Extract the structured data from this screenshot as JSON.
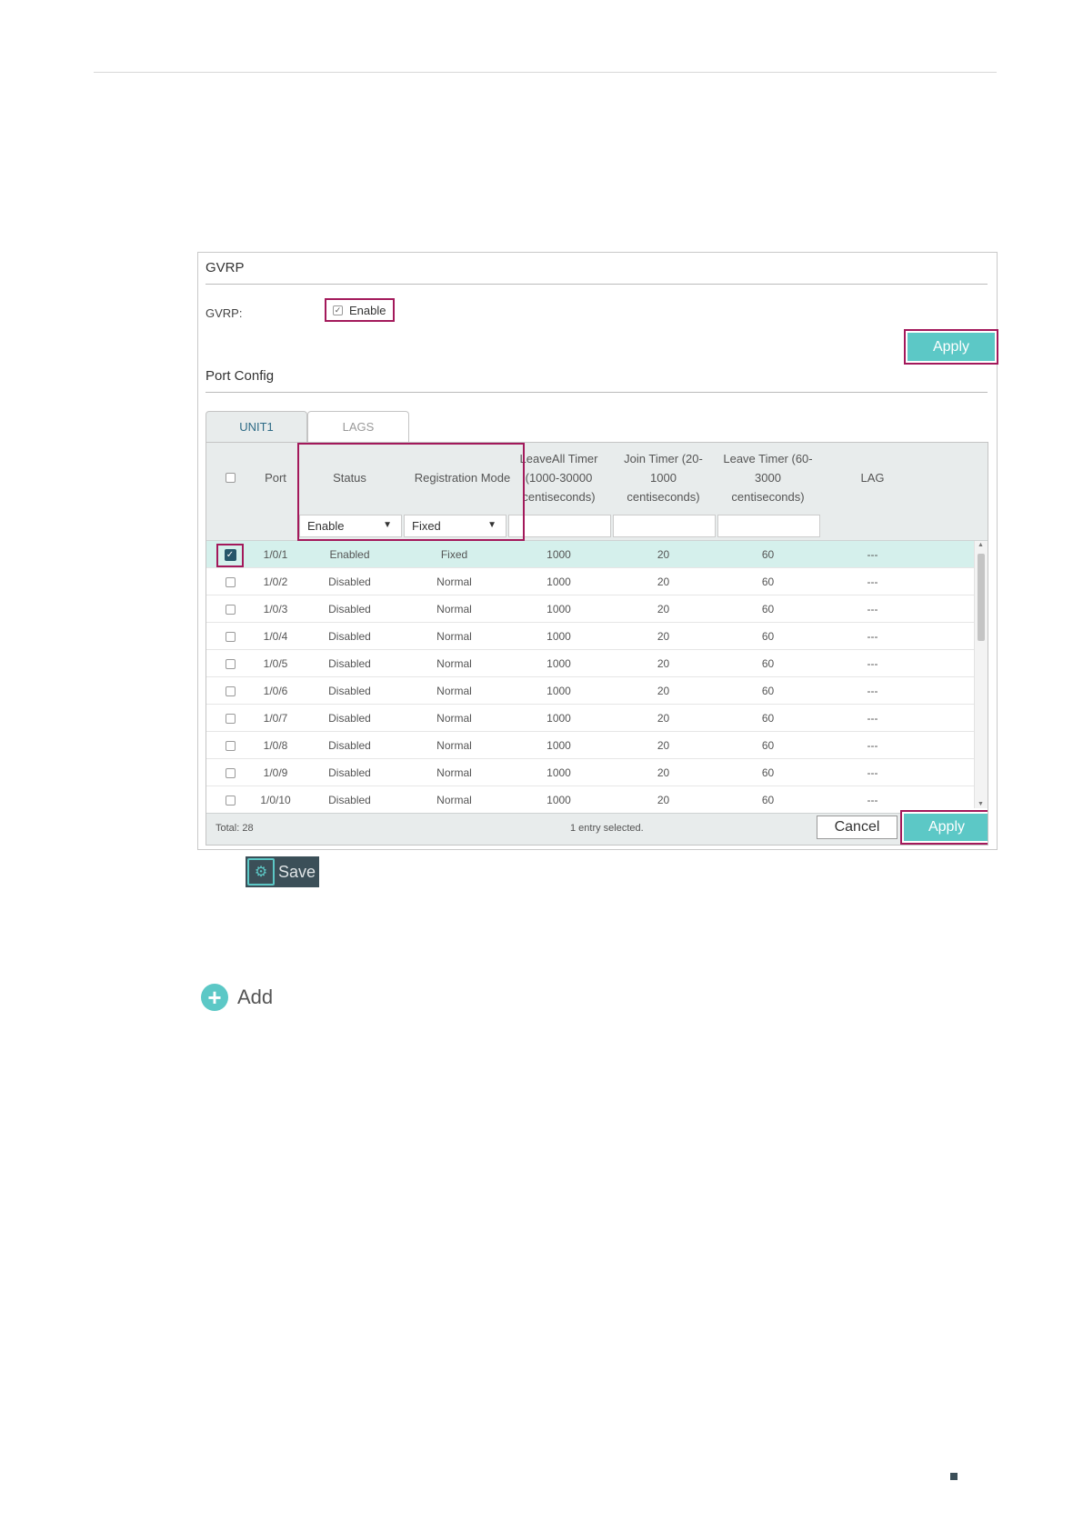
{
  "gvrp": {
    "title": "GVRP",
    "label": "GVRP:",
    "enable_label": "Enable",
    "enabled": true,
    "apply_label": "Apply"
  },
  "port_config": {
    "title": "Port Config",
    "tabs": [
      {
        "label": "UNIT1",
        "active": true
      },
      {
        "label": "LAGS",
        "active": false
      }
    ],
    "columns": {
      "port": "Port",
      "status": "Status",
      "registration_mode": "Registration Mode",
      "leaveall_line1": "LeaveAll Timer",
      "leaveall_line2": "(1000-30000",
      "leaveall_line3": "centiseconds)",
      "join_line1": "Join Timer (20-",
      "join_line2": "1000",
      "join_line3": "centiseconds)",
      "leave_line1": "Leave Timer (60-",
      "leave_line2": "3000",
      "leave_line3": "centiseconds)",
      "lag": "LAG"
    },
    "filter": {
      "status": "Enable",
      "registration_mode": "Fixed"
    },
    "rows": [
      {
        "port": "1/0/1",
        "status": "Enabled",
        "mode": "Fixed",
        "leaveall": "1000",
        "join": "20",
        "leave": "60",
        "lag": "---",
        "selected": true
      },
      {
        "port": "1/0/2",
        "status": "Disabled",
        "mode": "Normal",
        "leaveall": "1000",
        "join": "20",
        "leave": "60",
        "lag": "---",
        "selected": false
      },
      {
        "port": "1/0/3",
        "status": "Disabled",
        "mode": "Normal",
        "leaveall": "1000",
        "join": "20",
        "leave": "60",
        "lag": "---",
        "selected": false
      },
      {
        "port": "1/0/4",
        "status": "Disabled",
        "mode": "Normal",
        "leaveall": "1000",
        "join": "20",
        "leave": "60",
        "lag": "---",
        "selected": false
      },
      {
        "port": "1/0/5",
        "status": "Disabled",
        "mode": "Normal",
        "leaveall": "1000",
        "join": "20",
        "leave": "60",
        "lag": "---",
        "selected": false
      },
      {
        "port": "1/0/6",
        "status": "Disabled",
        "mode": "Normal",
        "leaveall": "1000",
        "join": "20",
        "leave": "60",
        "lag": "---",
        "selected": false
      },
      {
        "port": "1/0/7",
        "status": "Disabled",
        "mode": "Normal",
        "leaveall": "1000",
        "join": "20",
        "leave": "60",
        "lag": "---",
        "selected": false
      },
      {
        "port": "1/0/8",
        "status": "Disabled",
        "mode": "Normal",
        "leaveall": "1000",
        "join": "20",
        "leave": "60",
        "lag": "---",
        "selected": false
      },
      {
        "port": "1/0/9",
        "status": "Disabled",
        "mode": "Normal",
        "leaveall": "1000",
        "join": "20",
        "leave": "60",
        "lag": "---",
        "selected": false
      },
      {
        "port": "1/0/10",
        "status": "Disabled",
        "mode": "Normal",
        "leaveall": "1000",
        "join": "20",
        "leave": "60",
        "lag": "---",
        "selected": false
      }
    ],
    "footer": {
      "total": "Total: 28",
      "selection": "1 entry selected.",
      "cancel_label": "Cancel",
      "apply_label": "Apply"
    }
  },
  "save": {
    "label": "Save",
    "icon": "save-gear-icon"
  },
  "add": {
    "label": "Add",
    "icon": "plus-circle-icon"
  },
  "colors": {
    "accent": "#5cc8c6",
    "highlight_frame": "#a3195b",
    "selected_row": "#d5f0ec",
    "header_bg": "#e8ecec"
  }
}
